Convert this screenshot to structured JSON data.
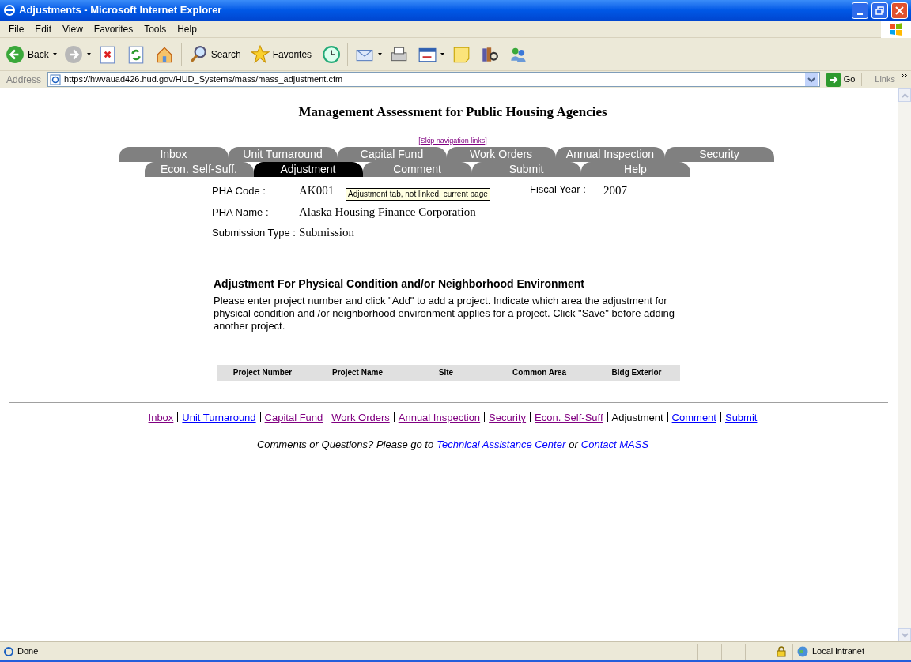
{
  "window": {
    "title": "Adjustments - Microsoft Internet Explorer"
  },
  "menu": [
    "File",
    "Edit",
    "View",
    "Favorites",
    "Tools",
    "Help"
  ],
  "toolbar": [
    {
      "kind": "back",
      "label": "Back"
    },
    {
      "kind": "forward"
    },
    {
      "kind": "stop"
    },
    {
      "kind": "refresh"
    },
    {
      "kind": "home"
    },
    {
      "kind": "search",
      "label": "Search"
    },
    {
      "kind": "favorites",
      "label": "Favorites"
    },
    {
      "kind": "history"
    },
    {
      "kind": "mail"
    },
    {
      "kind": "print"
    },
    {
      "kind": "edit"
    },
    {
      "kind": "note"
    },
    {
      "kind": "research"
    },
    {
      "kind": "messenger"
    }
  ],
  "address": {
    "label": "Address",
    "url": "https://hwvauad426.hud.gov/HUD_Systems/mass/mass_adjustment.cfm",
    "go": "Go",
    "links": "Links"
  },
  "page": {
    "heading": "Management Assessment for Public Housing Agencies",
    "skip_link": "[Skip navigation links]",
    "tab_rows": [
      [
        {
          "label": "Inbox",
          "selected": false
        },
        {
          "label": "Unit Turnaround",
          "selected": false
        },
        {
          "label": "Capital Fund",
          "selected": false
        },
        {
          "label": "Work Orders",
          "selected": false
        },
        {
          "label": "Annual Inspection",
          "selected": false
        },
        {
          "label": "Security",
          "selected": false
        }
      ],
      [
        {
          "label": "Econ. Self-Suff.",
          "selected": false
        },
        {
          "label": "Adjustment",
          "selected": true
        },
        {
          "label": "Comment",
          "selected": false
        },
        {
          "label": "Submit",
          "selected": false
        },
        {
          "label": "Help",
          "selected": false
        }
      ]
    ],
    "tooltip": "Adjustment tab, not linked, current page",
    "fields": [
      {
        "label": "PHA Code :",
        "value": "AK001"
      },
      {
        "label": "PHA Name :",
        "value": "Alaska Housing Finance Corporation"
      },
      {
        "label": "Submission Type :",
        "value": "Submission"
      }
    ],
    "fiscal_year": {
      "label": "Fiscal Year :",
      "value": "2007"
    },
    "section_title": "Adjustment For Physical Condition and/or Neighborhood Environment",
    "instructions": "Please enter project number and click \"Add\" to add a project. Indicate which area the adjustment for physical condition and /or neighborhood environment applies for a project. Click \"Save\" before adding another project.",
    "table": {
      "columns": [
        "Project Number",
        "Project Name",
        "Site",
        "Common Area",
        "Bldg Exterior"
      ]
    },
    "footer_links": [
      {
        "label": "Inbox",
        "kind": "visited"
      },
      {
        "label": "Unit Turnaround",
        "kind": "link"
      },
      {
        "label": "Capital Fund",
        "kind": "visited"
      },
      {
        "label": "Work Orders",
        "kind": "visited"
      },
      {
        "label": "Annual Inspection",
        "kind": "visited"
      },
      {
        "label": "Security",
        "kind": "visited"
      },
      {
        "label": "Econ. Self-Suff",
        "kind": "visited"
      },
      {
        "label": "Adjustment",
        "kind": "current"
      },
      {
        "label": "Comment",
        "kind": "link"
      },
      {
        "label": "Submit",
        "kind": "link"
      }
    ],
    "contact": {
      "text": "Comments or Questions? Please go to",
      "link1": "Technical Assistance Center",
      "or": "or",
      "link2": "Contact MASS"
    }
  },
  "status_bar": {
    "text": "Done",
    "zone": "Local intranet"
  }
}
